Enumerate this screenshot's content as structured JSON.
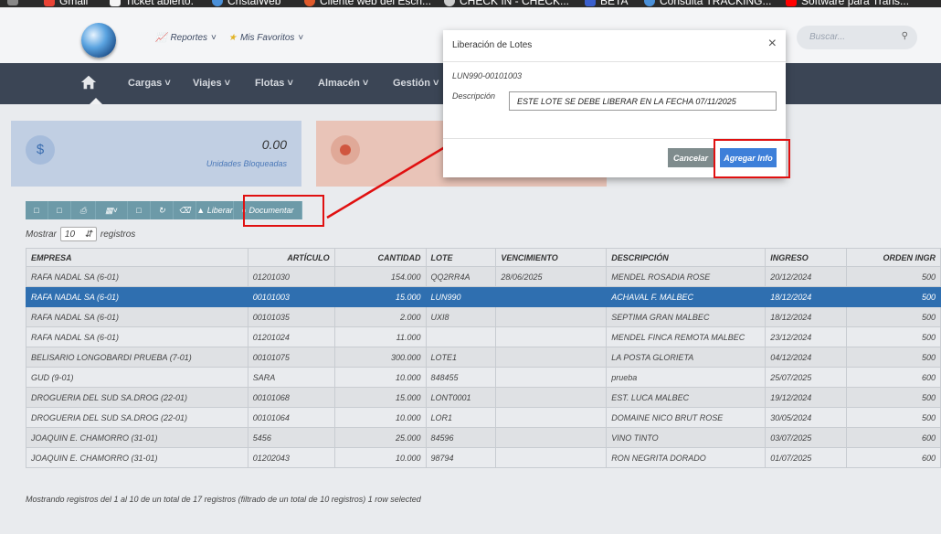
{
  "bookmarks": [
    {
      "label": "Gmail",
      "color": "#ea4335"
    },
    {
      "label": "Ticket abierto.",
      "color": "#f4f4f4"
    },
    {
      "label": "CristalWeb",
      "color": "#4a90d9"
    },
    {
      "label": "Cliente web del Escri...",
      "color": "#e05a2b"
    },
    {
      "label": "CHECK IN - CHECK...",
      "color": "#cccccc"
    },
    {
      "label": "BETA",
      "color": "#3a5fcd"
    },
    {
      "label": "Consulta TRACKING...",
      "color": "#4a90d9"
    },
    {
      "label": "Software para Trans...",
      "color": "#ff0000"
    }
  ],
  "header": {
    "reportes": "Reportes",
    "favoritos": "Mis Favoritos",
    "search_placeholder": "Buscar..."
  },
  "nav": {
    "items": [
      "Cargas",
      "Viajes",
      "Flotas",
      "Almacén",
      "Gestión"
    ]
  },
  "cards": [
    {
      "value": "0.00",
      "label": "Unidades Bloqueadas"
    }
  ],
  "toolbar": {
    "liberar": "Liberar",
    "documentar": "Documentar"
  },
  "table": {
    "show_label": "Mostrar",
    "page_size": "10",
    "records_label": "registros",
    "columns": [
      "EMPRESA",
      "ARTÍCULO",
      "CANTIDAD",
      "LOTE",
      "VENCIMIENTO",
      "DESCRIPCIÓN",
      "INGRESO",
      "ORDEN INGR"
    ],
    "rows": [
      [
        "RAFA NADAL SA (6-01)",
        "01201030",
        "154.000",
        "QQ2RR4A",
        "28/06/2025",
        "MENDEL ROSADIA ROSE",
        "20/12/2024",
        "500"
      ],
      [
        "RAFA NADAL SA (6-01)",
        "00101003",
        "15.000",
        "LUN990",
        "",
        "ACHAVAL F. MALBEC",
        "18/12/2024",
        "500"
      ],
      [
        "RAFA NADAL SA (6-01)",
        "00101035",
        "2.000",
        "UXI8",
        "",
        "SEPTIMA GRAN MALBEC",
        "18/12/2024",
        "500"
      ],
      [
        "RAFA NADAL SA (6-01)",
        "01201024",
        "11.000",
        "",
        "",
        "MENDEL FINCA REMOTA MALBEC",
        "23/12/2024",
        "500"
      ],
      [
        "BELISARIO LONGOBARDI PRUEBA (7-01)",
        "00101075",
        "300.000",
        "LOTE1",
        "",
        "LA POSTA GLORIETA",
        "04/12/2024",
        "500"
      ],
      [
        "GUD (9-01)",
        "SARA",
        "10.000",
        "848455",
        "",
        "prueba",
        "25/07/2025",
        "600"
      ],
      [
        "DROGUERIA DEL SUD SA.DROG (22-01)",
        "00101068",
        "15.000",
        "LONT0001",
        "",
        "EST. LUCA MALBEC",
        "19/12/2024",
        "500"
      ],
      [
        "DROGUERIA DEL SUD SA.DROG (22-01)",
        "00101064",
        "10.000",
        "LOR1",
        "",
        "DOMAINE NICO BRUT ROSE",
        "30/05/2024",
        "500"
      ],
      [
        "JOAQUIN E. CHAMORRO (31-01)",
        "5456",
        "25.000",
        "84596",
        "",
        "VINO TINTO",
        "03/07/2025",
        "600"
      ],
      [
        "JOAQUIN E. CHAMORRO (31-01)",
        "01202043",
        "10.000",
        "98794",
        "",
        "RON NEGRITA DORADO",
        "01/07/2025",
        "600"
      ]
    ],
    "footer": "Mostrando registros del 1 al 10 de un total de 17 registros (filtrado de un total de 10 registros)    1 row selected"
  },
  "modal": {
    "title": "Liberación de Lotes",
    "code": "LUN990-00101003",
    "description_label": "Descripción",
    "description_value": "ESTE LOTE SE DEBE LIBERAR EN LA FECHA 07/11/2025",
    "cancel_label": "Cancelar",
    "add_label": "Agregar Info"
  },
  "colors": {
    "highlight": "#e01010",
    "selected_row": "#2f6fb0",
    "primary_button": "#3d7fd9",
    "toolbar": "#6d9aa8",
    "nav": "#3b4555"
  }
}
